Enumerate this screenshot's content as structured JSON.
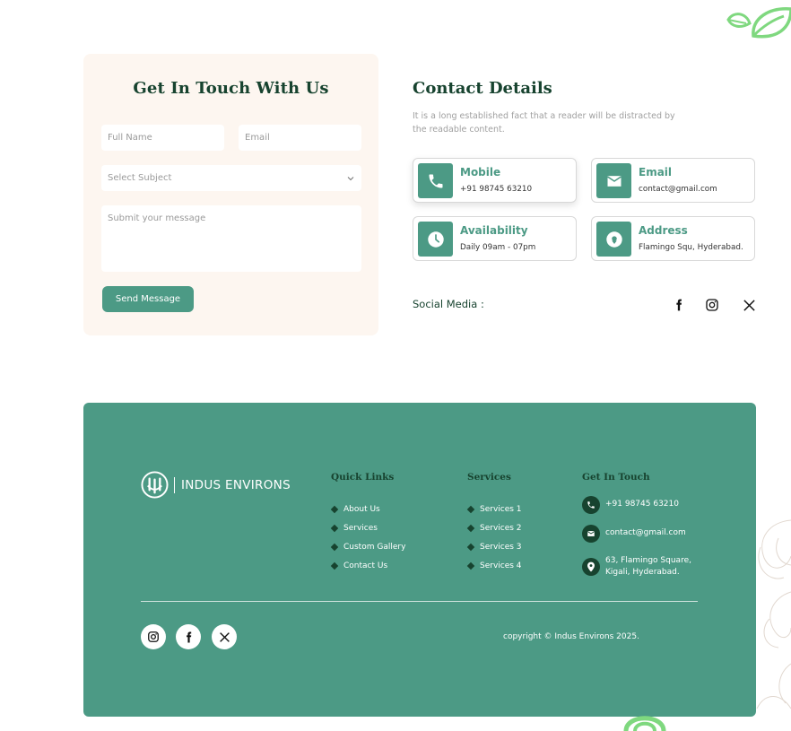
{
  "form": {
    "title": "Get In Touch With Us",
    "full_name_placeholder": "Full Name",
    "email_placeholder": "Email",
    "subject_placeholder": "Select Subject",
    "message_placeholder": "Submit your message",
    "send_label": "Send Message"
  },
  "contact_details": {
    "title": "Contact Details",
    "description": "It is a long established fact that a reader will be distracted by the readable content.",
    "cards": [
      {
        "label": "Mobile",
        "value": "+91 98745 63210",
        "icon": "phone-icon"
      },
      {
        "label": "Email",
        "value": "contact@gmail.com",
        "icon": "mail-icon"
      },
      {
        "label": "Availability",
        "value": "Daily 09am - 07pm",
        "icon": "clock-icon"
      },
      {
        "label": "Address",
        "value": "Flamingo Squ, Hyderabad.",
        "icon": "location-pin-icon"
      }
    ],
    "social_label": "Social Media :",
    "social_icons": [
      "facebook-icon",
      "instagram-icon",
      "x-icon"
    ]
  },
  "footer": {
    "brand": "INDUS ENVIRONS",
    "quick_links": {
      "title": "Quick Links",
      "items": [
        "About Us",
        "Services",
        "Custom Gallery",
        "Contact Us"
      ]
    },
    "services": {
      "title": "Services",
      "items": [
        "Services 1",
        "Services 2",
        "Services 3",
        "Services 4"
      ]
    },
    "get_in_touch": {
      "title": "Get In Touch",
      "phone": "+91 98745 63210",
      "email": "contact@gmail.com",
      "address_line1": "63, Flamingo Square,",
      "address_line2": "Kigali, Hyderabad."
    },
    "copyright": "copyright © Indus Environs 2025.",
    "social_icons": [
      "instagram-icon",
      "facebook-icon",
      "x-icon"
    ]
  },
  "colors": {
    "accent": "#4c9a85",
    "dark_green": "#17432f",
    "form_bg": "#fdf6f0",
    "decor_green": "#7fd87f"
  }
}
